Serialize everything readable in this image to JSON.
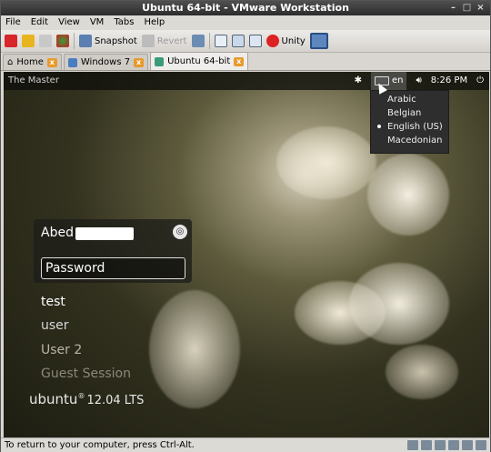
{
  "window": {
    "title": "Ubuntu 64-bit - VMware Workstation"
  },
  "menu": [
    "File",
    "Edit",
    "View",
    "VM",
    "Tabs",
    "Help"
  ],
  "toolbar": {
    "snapshot_label": "Snapshot",
    "revert_label": "Revert",
    "unity_label": "Unity"
  },
  "tabs": [
    {
      "label": "Home",
      "active": false
    },
    {
      "label": "Windows 7",
      "active": false
    },
    {
      "label": "Ubuntu 64-bit",
      "active": true
    }
  ],
  "guest": {
    "panel_title": "The Master",
    "keyboard_layout": "en",
    "clock": "8:26 PM",
    "layout_menu": [
      {
        "label": "Arabic",
        "selected": false
      },
      {
        "label": "Belgian",
        "selected": false
      },
      {
        "label": "English (US)",
        "selected": true
      },
      {
        "label": "Macedonian",
        "selected": false
      }
    ],
    "login": {
      "user_first_name": "Abed",
      "password_placeholder": "Password",
      "other_users": [
        "test",
        "user",
        "User 2",
        "Guest Session"
      ]
    },
    "brand": "ubuntu",
    "brand_mark": "®",
    "version": "12.04 LTS"
  },
  "status_bar": {
    "text": "To return to your computer, press Ctrl-Alt."
  },
  "colors": {
    "accent_orange": "#e89a2c",
    "panel_bg": "#1a1a16"
  }
}
